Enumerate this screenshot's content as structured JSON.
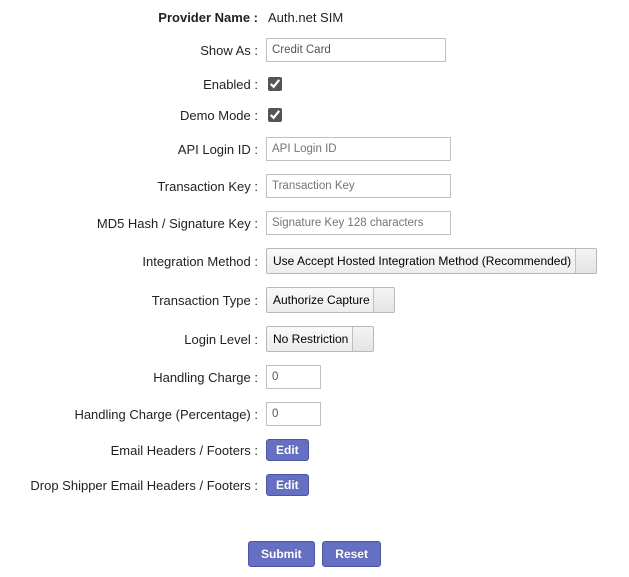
{
  "provider": {
    "nameLabel": "Provider Name :",
    "nameValue": "Auth.net SIM",
    "showAsLabel": "Show As :",
    "showAsValue": "Credit Card",
    "enabledLabel": "Enabled :",
    "enabledChecked": true,
    "demoLabel": "Demo Mode :",
    "demoChecked": true,
    "apiLoginLabel": "API Login ID :",
    "apiLoginPlaceholder": "API Login ID",
    "apiLoginValue": "",
    "transKeyLabel": "Transaction Key :",
    "transKeyPlaceholder": "Transaction Key",
    "transKeyValue": "",
    "md5Label": "MD5 Hash / Signature Key :",
    "md5Placeholder": "Signature Key 128 characters",
    "md5Value": "",
    "integrationLabel": "Integration Method :",
    "integrationSelected": "Use Accept Hosted Integration Method (Recommended)",
    "transTypeLabel": "Transaction Type :",
    "transTypeSelected": "Authorize Capture",
    "loginLevelLabel": "Login Level :",
    "loginLevelSelected": "No Restriction",
    "handlingLabel": "Handling Charge :",
    "handlingValue": "0",
    "handlingPctLabel": "Handling Charge (Percentage) :",
    "handlingPctValue": "0",
    "emailHFLabel": "Email Headers / Footers :",
    "dropShipHFLabel": "Drop Shipper Email Headers / Footers :"
  },
  "buttons": {
    "edit": "Edit",
    "submit": "Submit",
    "reset": "Reset"
  }
}
